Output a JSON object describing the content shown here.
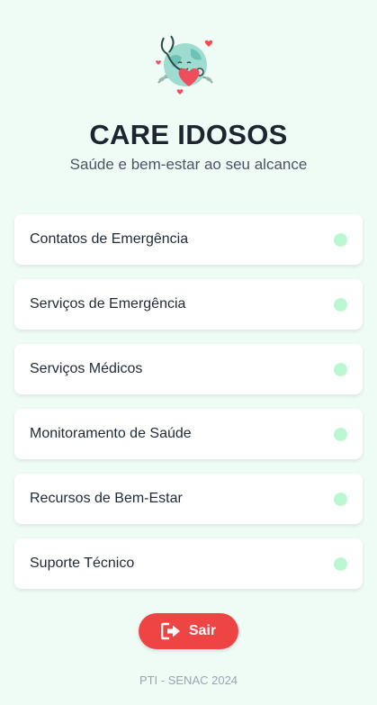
{
  "app": {
    "title": "CARE IDOSOS",
    "subtitle": "Saúde e bem-estar ao seu alcance",
    "logo_icon": "globe-heart-stethoscope-icon"
  },
  "menu": {
    "items": [
      {
        "label": "Contatos de Emergência"
      },
      {
        "label": "Serviços de Emergência"
      },
      {
        "label": "Serviços Médicos"
      },
      {
        "label": "Monitoramento de Saúde"
      },
      {
        "label": "Recursos de Bem-Estar"
      },
      {
        "label": "Suporte Técnico"
      }
    ],
    "indicator_color": "#bbf7d0"
  },
  "exit": {
    "label": "Sair",
    "icon": "sign-out-icon",
    "color": "#ef4444"
  },
  "footer": {
    "text": "PTI - SENAC 2024"
  },
  "colors": {
    "background": "#effcf5",
    "card": "#ffffff",
    "title": "#1c2530"
  }
}
